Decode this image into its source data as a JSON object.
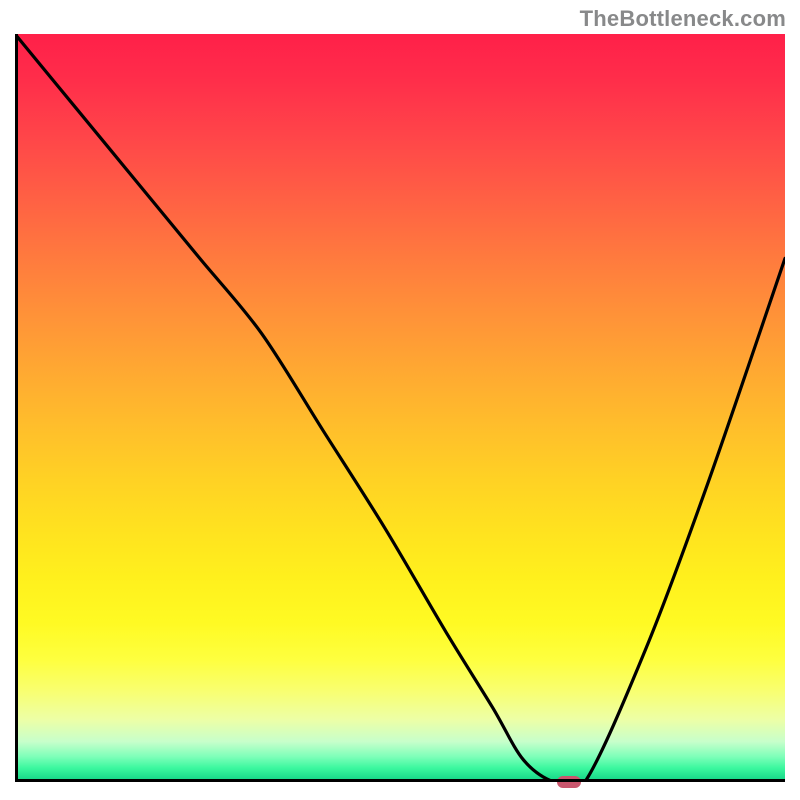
{
  "watermark": "TheBottleneck.com",
  "chart_data": {
    "type": "line",
    "title": "",
    "xlabel": "",
    "ylabel": "",
    "xlim": [
      0,
      100
    ],
    "ylim": [
      0,
      100
    ],
    "series": [
      {
        "name": "curve",
        "x": [
          0,
          8,
          16,
          24,
          32,
          40,
          48,
          56,
          62,
          66,
          70,
          74,
          82,
          90,
          100
        ],
        "values": [
          100,
          90,
          80,
          70,
          60,
          47,
          34,
          20,
          10,
          3,
          0,
          0,
          18,
          40,
          70
        ]
      }
    ],
    "marker": {
      "x": 72,
      "y": 0,
      "color": "#c9566d"
    },
    "gradient_stops": [
      {
        "pos": 0,
        "color": "#ff2049"
      },
      {
        "pos": 50,
        "color": "#ffbf2b"
      },
      {
        "pos": 84,
        "color": "#feff3f"
      },
      {
        "pos": 100,
        "color": "#19d98a"
      }
    ]
  }
}
